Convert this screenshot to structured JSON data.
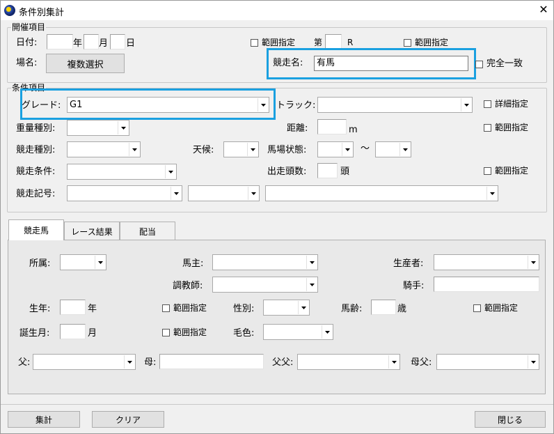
{
  "window": {
    "title": "条件別集計",
    "close_glyph": "✕"
  },
  "kaisai": {
    "group_label": "開催項目",
    "date_label": "日付:",
    "year_unit": "年",
    "month_unit": "月",
    "day_unit": "日",
    "range_label": "範囲指定",
    "race_no_prefix": "第",
    "race_no_suffix": "R",
    "race_range_label": "範囲指定",
    "venue_label": "場名:",
    "venue_button": "複数選択",
    "race_name_label": "競走名:",
    "race_name_value": "有馬",
    "exact_match_label": "完全一致"
  },
  "joken": {
    "group_label": "条件項目",
    "grade_label": "グレード:",
    "grade_value": "G1",
    "track_label": "トラック:",
    "detail_label": "詳細指定",
    "weight_label": "重量種別:",
    "distance_label": "距離:",
    "distance_unit": "m",
    "distance_range_label": "範囲指定",
    "race_type_label": "競走種別:",
    "weather_label": "天候:",
    "baba_label": "馬場状態:",
    "tilde": "～",
    "condition_label": "競走条件:",
    "runners_label": "出走頭数:",
    "runners_unit": "頭",
    "runners_range_label": "範囲指定",
    "symbol_label": "競走記号:"
  },
  "tabs": [
    "競走馬",
    "レース結果",
    "配当"
  ],
  "horse": {
    "affiliation_label": "所属:",
    "owner_label": "馬主:",
    "breeder_label": "生産者:",
    "trainer_label": "調教師:",
    "jockey_label": "騎手:",
    "birth_year_label": "生年:",
    "birth_year_unit": "年",
    "birth_year_range_label": "範囲指定",
    "sex_label": "性別:",
    "age_label": "馬齢:",
    "age_unit": "歳",
    "age_range_label": "範囲指定",
    "birth_month_label": "誕生月:",
    "birth_month_unit": "月",
    "birth_month_range_label": "範囲指定",
    "color_label": "毛色:",
    "sire_label": "父:",
    "dam_label": "母:",
    "broodmare_sire_label": "父父:",
    "dam_sire_label": "母父:"
  },
  "buttons": {
    "aggregate": "集計",
    "clear": "クリア",
    "close": "閉じる"
  },
  "accent_color": "#1aa0e0"
}
